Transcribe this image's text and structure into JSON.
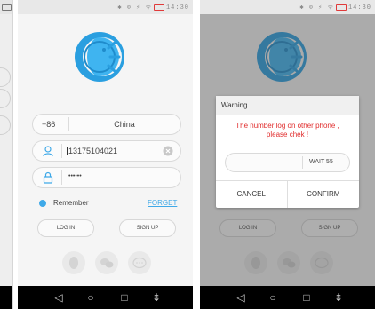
{
  "status_bar": {
    "icons": "✱ ⊙ ⚡ ᯤ",
    "time": "14:30"
  },
  "login": {
    "country_code": "+86",
    "country_name": "China",
    "phone_value": "13175104021",
    "password_masked": "••••••",
    "remember_label": "Remember",
    "forget_label": "FORGET",
    "login_label": "LOG IN",
    "signup_label": "SIGN UP"
  },
  "dialog": {
    "title": "Warning",
    "message_line1": "The number log on other phone ,",
    "message_line2": "please chek !",
    "wait_label": "WAIT 55",
    "cancel_label": "CANCEL",
    "confirm_label": "CONFIRM"
  },
  "social_icons": [
    "qq-icon",
    "wechat-icon",
    "chat-icon"
  ],
  "nav_icons": [
    "back-icon",
    "home-icon",
    "recents-icon",
    "menu-icon"
  ],
  "colors": {
    "accent": "#3fa9e8",
    "logo_blue": "#2a9fe0",
    "warning_red": "#e02b2b",
    "forget_link": "#3fa9e8"
  }
}
